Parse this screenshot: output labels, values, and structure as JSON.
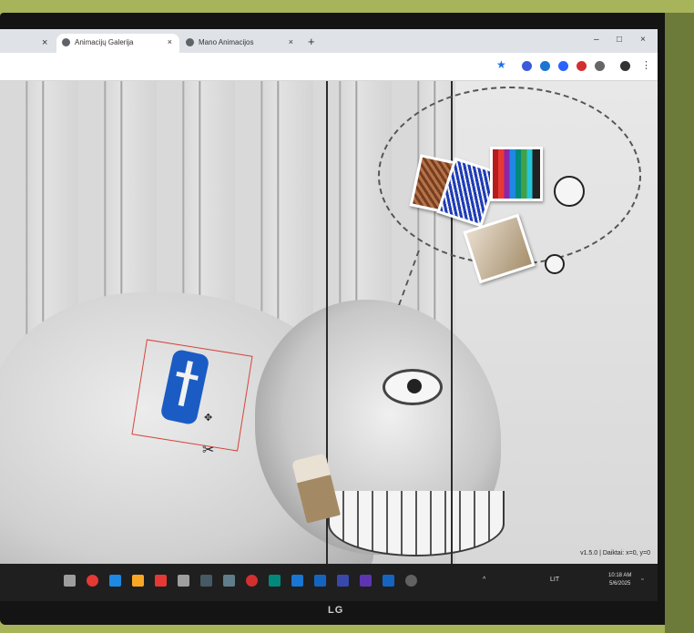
{
  "browser": {
    "tabs": [
      {
        "label": "Animacijų Galerija",
        "active": true
      },
      {
        "label": "Mano Animacijos",
        "active": false
      }
    ],
    "new_tab_symbol": "+",
    "close_symbol": "×",
    "window_controls": {
      "minimize": "–",
      "maximize": "□",
      "close": "×"
    },
    "toolbar_icons": [
      "star-icon",
      "extension-icon",
      "extension-icon",
      "extension-icon",
      "extension-icon",
      "puzzle-icon",
      "profile-icon",
      "menu-icon"
    ]
  },
  "canvas": {
    "status": "v1.5.0 | Daiktai: x=0, y=0",
    "selected_sticker": "cross-sticker",
    "thought_bubble_items": [
      "brown-sticker",
      "blue-sticker",
      "colored-pencils-sticker",
      "paper-sticker",
      "face-circle-icon",
      "small-circle-icon"
    ]
  },
  "monitor": {
    "brand": "LG"
  },
  "taskbar": {
    "apps": [
      "start",
      "chrome",
      "store",
      "explorer",
      "youtube",
      "app",
      "app",
      "app",
      "opera",
      "app",
      "app",
      "zoom",
      "app",
      "viber",
      "word",
      "app"
    ],
    "tray": {
      "lang": "LIT",
      "time": "10:18 AM",
      "date": "5/6/2025"
    }
  },
  "colors": {
    "accent_blue": "#1b5cc4",
    "selection_red": "#d6453d",
    "taskbar": "#1f1f1f"
  }
}
